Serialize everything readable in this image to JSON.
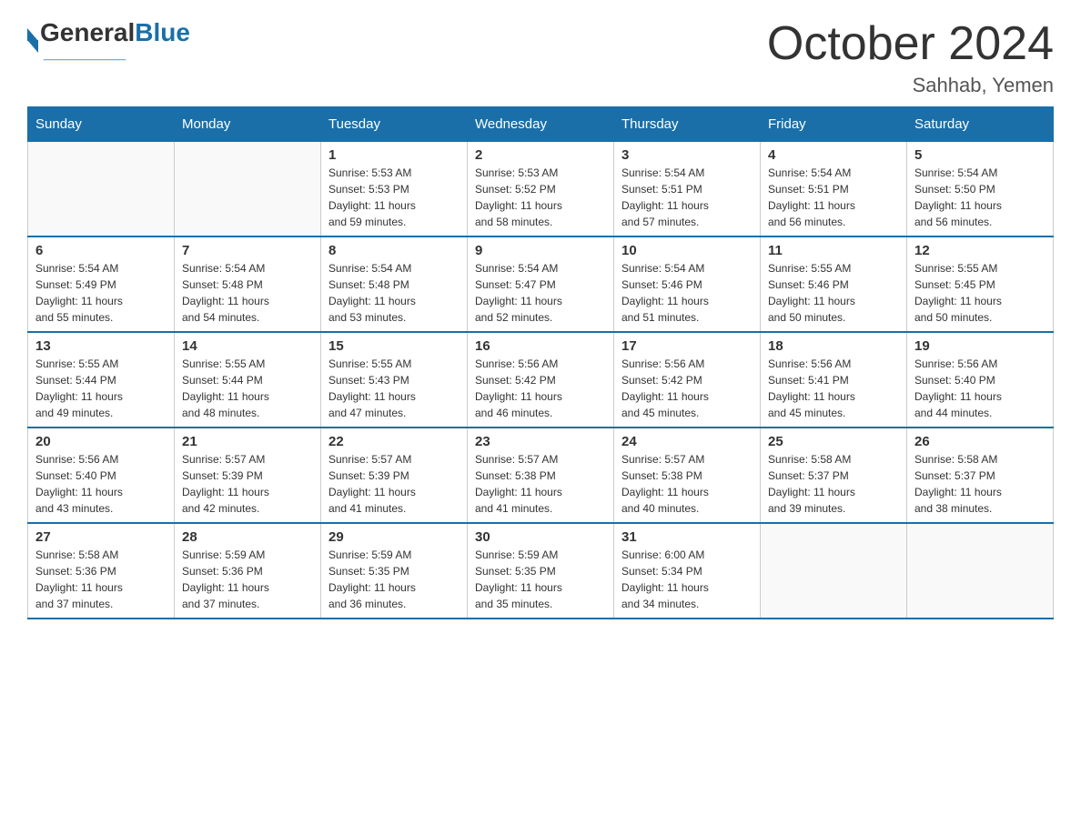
{
  "header": {
    "logo_general": "General",
    "logo_blue": "Blue",
    "main_title": "October 2024",
    "subtitle": "Sahhab, Yemen"
  },
  "days_of_week": [
    "Sunday",
    "Monday",
    "Tuesday",
    "Wednesday",
    "Thursday",
    "Friday",
    "Saturday"
  ],
  "weeks": [
    [
      {
        "day": "",
        "info": ""
      },
      {
        "day": "",
        "info": ""
      },
      {
        "day": "1",
        "sunrise": "5:53 AM",
        "sunset": "5:53 PM",
        "daylight": "11 hours and 59 minutes."
      },
      {
        "day": "2",
        "sunrise": "5:53 AM",
        "sunset": "5:52 PM",
        "daylight": "11 hours and 58 minutes."
      },
      {
        "day": "3",
        "sunrise": "5:54 AM",
        "sunset": "5:51 PM",
        "daylight": "11 hours and 57 minutes."
      },
      {
        "day": "4",
        "sunrise": "5:54 AM",
        "sunset": "5:51 PM",
        "daylight": "11 hours and 56 minutes."
      },
      {
        "day": "5",
        "sunrise": "5:54 AM",
        "sunset": "5:50 PM",
        "daylight": "11 hours and 56 minutes."
      }
    ],
    [
      {
        "day": "6",
        "sunrise": "5:54 AM",
        "sunset": "5:49 PM",
        "daylight": "11 hours and 55 minutes."
      },
      {
        "day": "7",
        "sunrise": "5:54 AM",
        "sunset": "5:48 PM",
        "daylight": "11 hours and 54 minutes."
      },
      {
        "day": "8",
        "sunrise": "5:54 AM",
        "sunset": "5:48 PM",
        "daylight": "11 hours and 53 minutes."
      },
      {
        "day": "9",
        "sunrise": "5:54 AM",
        "sunset": "5:47 PM",
        "daylight": "11 hours and 52 minutes."
      },
      {
        "day": "10",
        "sunrise": "5:54 AM",
        "sunset": "5:46 PM",
        "daylight": "11 hours and 51 minutes."
      },
      {
        "day": "11",
        "sunrise": "5:55 AM",
        "sunset": "5:46 PM",
        "daylight": "11 hours and 50 minutes."
      },
      {
        "day": "12",
        "sunrise": "5:55 AM",
        "sunset": "5:45 PM",
        "daylight": "11 hours and 50 minutes."
      }
    ],
    [
      {
        "day": "13",
        "sunrise": "5:55 AM",
        "sunset": "5:44 PM",
        "daylight": "11 hours and 49 minutes."
      },
      {
        "day": "14",
        "sunrise": "5:55 AM",
        "sunset": "5:44 PM",
        "daylight": "11 hours and 48 minutes."
      },
      {
        "day": "15",
        "sunrise": "5:55 AM",
        "sunset": "5:43 PM",
        "daylight": "11 hours and 47 minutes."
      },
      {
        "day": "16",
        "sunrise": "5:56 AM",
        "sunset": "5:42 PM",
        "daylight": "11 hours and 46 minutes."
      },
      {
        "day": "17",
        "sunrise": "5:56 AM",
        "sunset": "5:42 PM",
        "daylight": "11 hours and 45 minutes."
      },
      {
        "day": "18",
        "sunrise": "5:56 AM",
        "sunset": "5:41 PM",
        "daylight": "11 hours and 45 minutes."
      },
      {
        "day": "19",
        "sunrise": "5:56 AM",
        "sunset": "5:40 PM",
        "daylight": "11 hours and 44 minutes."
      }
    ],
    [
      {
        "day": "20",
        "sunrise": "5:56 AM",
        "sunset": "5:40 PM",
        "daylight": "11 hours and 43 minutes."
      },
      {
        "day": "21",
        "sunrise": "5:57 AM",
        "sunset": "5:39 PM",
        "daylight": "11 hours and 42 minutes."
      },
      {
        "day": "22",
        "sunrise": "5:57 AM",
        "sunset": "5:39 PM",
        "daylight": "11 hours and 41 minutes."
      },
      {
        "day": "23",
        "sunrise": "5:57 AM",
        "sunset": "5:38 PM",
        "daylight": "11 hours and 41 minutes."
      },
      {
        "day": "24",
        "sunrise": "5:57 AM",
        "sunset": "5:38 PM",
        "daylight": "11 hours and 40 minutes."
      },
      {
        "day": "25",
        "sunrise": "5:58 AM",
        "sunset": "5:37 PM",
        "daylight": "11 hours and 39 minutes."
      },
      {
        "day": "26",
        "sunrise": "5:58 AM",
        "sunset": "5:37 PM",
        "daylight": "11 hours and 38 minutes."
      }
    ],
    [
      {
        "day": "27",
        "sunrise": "5:58 AM",
        "sunset": "5:36 PM",
        "daylight": "11 hours and 37 minutes."
      },
      {
        "day": "28",
        "sunrise": "5:59 AM",
        "sunset": "5:36 PM",
        "daylight": "11 hours and 37 minutes."
      },
      {
        "day": "29",
        "sunrise": "5:59 AM",
        "sunset": "5:35 PM",
        "daylight": "11 hours and 36 minutes."
      },
      {
        "day": "30",
        "sunrise": "5:59 AM",
        "sunset": "5:35 PM",
        "daylight": "11 hours and 35 minutes."
      },
      {
        "day": "31",
        "sunrise": "6:00 AM",
        "sunset": "5:34 PM",
        "daylight": "11 hours and 34 minutes."
      },
      {
        "day": "",
        "info": ""
      },
      {
        "day": "",
        "info": ""
      }
    ]
  ]
}
